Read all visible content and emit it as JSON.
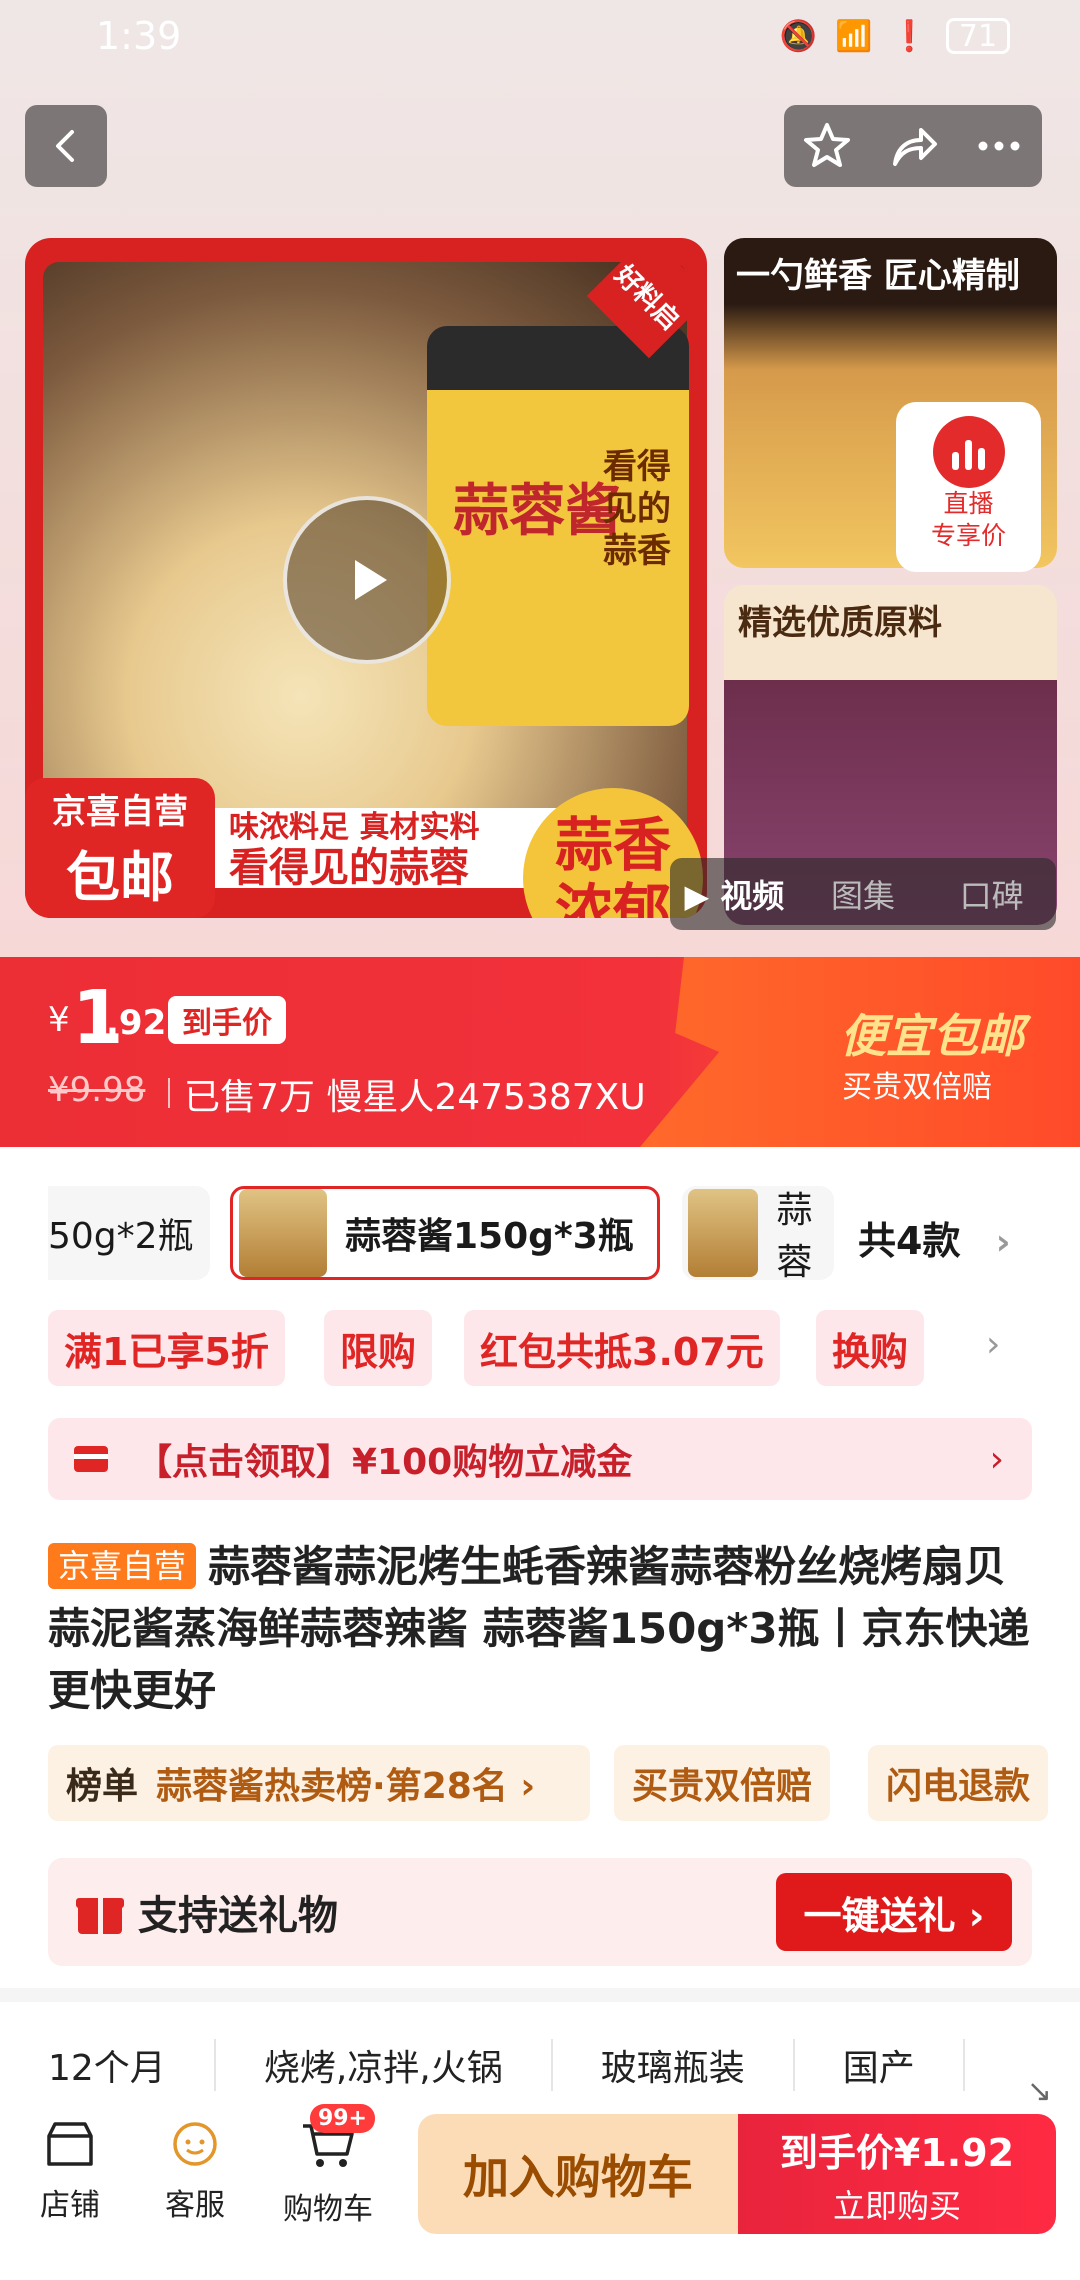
{
  "status_bar": {
    "time": "1:39",
    "battery": "71"
  },
  "gallery": {
    "main_jar_title": "蒜蓉酱",
    "main_jar_side": "看得见的蒜香",
    "corner_badge": "好料启",
    "jingxi_label_1": "京喜自营",
    "jingxi_label_2": "包邮",
    "banner_line_1": "味浓料足 真材实料",
    "banner_line_2": "看得见的蒜蓉",
    "fragrance_1": "蒜香",
    "fragrance_2": "浓郁",
    "side_top_title": "一勺鲜香 匠心精制",
    "side_bottom_title": "精选优质原料",
    "live_label_1": "直播",
    "live_label_2": "专享价",
    "media_tabs": [
      "视频",
      "图集",
      "口碑"
    ]
  },
  "price": {
    "currency": "¥",
    "integer": "1",
    "decimal": ".92",
    "tag": "到手价",
    "original": "¥9.98",
    "sold": "已售7万 慢星人2475387XU",
    "promo_title": "便宜包邮",
    "promo_sub": "买贵双倍赔"
  },
  "variants": {
    "items": [
      "50g*2瓶",
      "蒜蓉酱150g*3瓶",
      "蒜蓉"
    ],
    "count": "共4款"
  },
  "promos": [
    "满1已享5折",
    "限购",
    "红包共抵3.07元",
    "换购"
  ],
  "coupon": {
    "text": "【点击领取】¥100购物立减金"
  },
  "title": {
    "tag": "京喜自营",
    "text": "蒜蓉酱蒜泥烤生蚝香辣酱蒜蓉粉丝烧烤扇贝蒜泥酱蒸海鲜蒜蓉辣酱 蒜蓉酱150g*3瓶丨京东快递 更快更好"
  },
  "rank": {
    "key": "榜单",
    "value": "蒜蓉酱热卖榜·第28名 ›",
    "chip_2": "买贵双倍赔",
    "chip_3": "闪电退款"
  },
  "gift": {
    "text": "支持送礼物",
    "button": "一键送礼 ›"
  },
  "specs": [
    "12个月",
    "烧烤,凉拌,火锅",
    "玻璃瓶装",
    "国产"
  ],
  "bottom_bar": {
    "store": "店铺",
    "service": "客服",
    "cart": "购物车",
    "cart_badge": "99+",
    "add_to_cart": "加入购物车",
    "buy_line_1": "到手价¥1.92",
    "buy_line_2": "立即购买"
  },
  "colors": {
    "brand_red": "#e02525",
    "price_band": "#f2313b",
    "promo_orange": "#ff6a2a"
  }
}
